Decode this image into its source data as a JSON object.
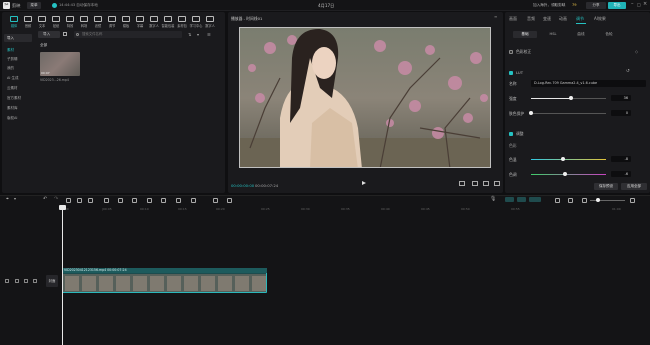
{
  "app": {
    "logo_glyph": "✂",
    "title": "剪映",
    "menu_label": "菜单",
    "status_text": "14:44:43 自动保存本地",
    "window_title": "4月17日",
    "user_text": "加入海外，领取剪映",
    "user_badge": "79",
    "share_label": "分享",
    "export_label": "导出"
  },
  "toolbar": {
    "items": [
      {
        "label": "媒体",
        "icon": "media-icon"
      },
      {
        "label": "音频",
        "icon": "audio-icon"
      },
      {
        "label": "文本",
        "icon": "text-icon"
      },
      {
        "label": "贴纸",
        "icon": "sticker-icon"
      },
      {
        "label": "特效",
        "icon": "effects-icon"
      },
      {
        "label": "转场",
        "icon": "transition-icon"
      },
      {
        "label": "滤镜",
        "icon": "filter-icon"
      },
      {
        "label": "调节",
        "icon": "adjust-icon"
      },
      {
        "label": "模板",
        "icon": "template-icon"
      },
      {
        "label": "字幕",
        "icon": "caption-icon"
      },
      {
        "label": "数字人",
        "icon": "digital-human-icon"
      },
      {
        "label": "智能包装",
        "icon": "smart-pack-icon"
      },
      {
        "label": "素材包",
        "icon": "asset-pack-icon"
      },
      {
        "label": "学习中心",
        "icon": "learn-icon"
      },
      {
        "label": "数字人",
        "icon": "avatar-icon"
      }
    ]
  },
  "media": {
    "side_items": [
      "导入",
      "素材",
      "子剪辑",
      "我的",
      "AI 生成",
      "云素材",
      "官方素材",
      "素材库",
      "版权AI"
    ],
    "import_label": "导入",
    "search_placeholder": "搜索文件名称",
    "section_label": "全部",
    "thumb_name": "VID2023...26.mp4",
    "thumb_duration": "00:07"
  },
  "player": {
    "title": "播放器 - 时间线01",
    "timecode_current": "00:00:00:00",
    "timecode_total": "00:00:07:24"
  },
  "inspector": {
    "tabs": [
      "画面",
      "音频",
      "变速",
      "动画",
      "调节",
      "AI效果"
    ],
    "active_tab": "调节",
    "subtabs": [
      "基础",
      "HSL",
      "曲线",
      "色轮"
    ],
    "color_correct_label": "色彩校正",
    "lut_label": "LUT",
    "lut_name_label": "名称",
    "lut_value": "D-Log-Rec.709 Gamma2.4_v1.6.cube",
    "intensity_label": "强度",
    "intensity_value": "36",
    "skin_label": "肤色保护",
    "skin_value": "0",
    "adjust_label": "调整",
    "color_label": "色彩",
    "temp_label": "色温",
    "temp_value": "-8",
    "tint_label": "色调",
    "tint_value": "-6",
    "save_preset_label": "保存预设",
    "apply_all_label": "应用全部"
  },
  "timeline": {
    "ruler": [
      "00:00",
      "|00:05",
      "00:10",
      "00:15",
      "00:20",
      "00:25",
      "00:30",
      "00:35",
      "00:40",
      "00:45",
      "00:50",
      "00:55",
      "01:00"
    ],
    "cover_label": "封面",
    "clip_label": "VID20230412123156.mp4  00:00:07:24"
  }
}
